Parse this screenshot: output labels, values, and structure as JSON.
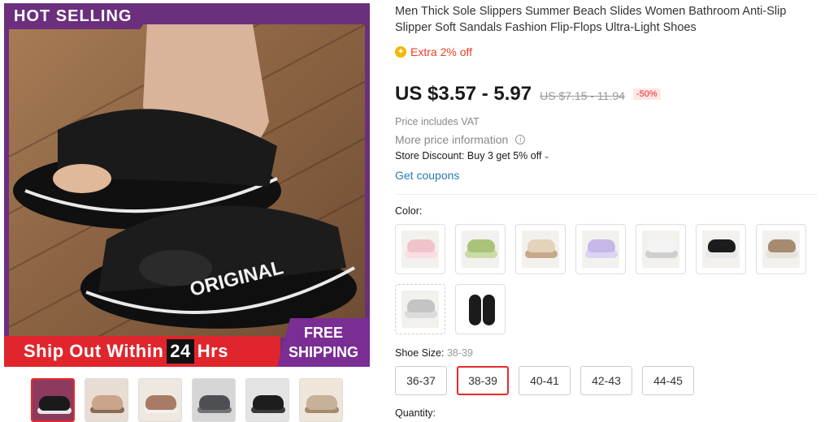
{
  "gallery": {
    "badge_text": "HOT SELLING",
    "product_text": "ORIGINAL",
    "ship_text_a": "Ship Out Within",
    "ship_num": "24",
    "ship_text_b": "Hrs",
    "free_line1": "FREE",
    "free_line2": "SHIPPING",
    "thumbnails": [
      {
        "name": "thumb-1",
        "strap": "#1a1a1a",
        "sole": "#e7e7e7",
        "bg": "#8c3a5e"
      },
      {
        "name": "thumb-2",
        "strap": "#caa48b",
        "sole": "#8a6a55",
        "bg": "#e8ddd2"
      },
      {
        "name": "thumb-3",
        "strap": "#a77b65",
        "sole": "#f3f1ee",
        "bg": "#efe8e0"
      },
      {
        "name": "thumb-4",
        "strap": "#4e4f52",
        "sole": "#707275",
        "bg": "#d6d6d6"
      },
      {
        "name": "thumb-5",
        "strap": "#1d1d1d",
        "sole": "#3a3a3a",
        "bg": "#e4e4e4"
      },
      {
        "name": "thumb-6",
        "strap": "#c7b197",
        "sole": "#a38a70",
        "bg": "#efe6da"
      }
    ]
  },
  "product": {
    "title": "Men Thick Sole Slippers Summer Beach Slides Women Bathroom Anti-Slip Slipper Soft Sandals Fashion Flip-Flops Ultra-Light Shoes",
    "extra_discount": "Extra 2% off",
    "price": "US $3.57 - 5.97",
    "original_price": "US $7.15 - 11.94",
    "discount_pct": "-50%",
    "vat_note": "Price includes VAT",
    "more_info": "More price information",
    "store_discount": "Store Discount: Buy 3 get 5% off",
    "coupons_link": "Get coupons"
  },
  "color": {
    "label": "Color:",
    "swatches": [
      {
        "name": "pink",
        "strap": "#f1c3cb",
        "sole": "#f7dfe3"
      },
      {
        "name": "green",
        "strap": "#a9c47a",
        "sole": "#c9dca6"
      },
      {
        "name": "beige",
        "strap": "#e3d3bc",
        "sole": "#c5a989"
      },
      {
        "name": "purple",
        "strap": "#c7b8e8",
        "sole": "#ddd3f2"
      },
      {
        "name": "white",
        "strap": "#f4f4f4",
        "sole": "#cfcfcf"
      },
      {
        "name": "black",
        "strap": "#1c1c1c",
        "sole": "#e9e9e9"
      },
      {
        "name": "brown",
        "strap": "#a78b70",
        "sole": "#e6e1da"
      },
      {
        "name": "gray",
        "strap": "#c4c4c4",
        "sole": "#dcdcdc"
      },
      {
        "name": "black-pair",
        "strap": "#1b1b1b",
        "sole": "#1b1b1b"
      }
    ]
  },
  "size": {
    "label": "Shoe Size:",
    "selected": "38-39",
    "options": [
      "36-37",
      "38-39",
      "40-41",
      "42-43",
      "44-45"
    ]
  },
  "quantity": {
    "label": "Quantity:"
  },
  "colors": {
    "accent": "#e62b2b",
    "link": "#2a7ab0",
    "banner_purple": "#6b2f7e"
  }
}
